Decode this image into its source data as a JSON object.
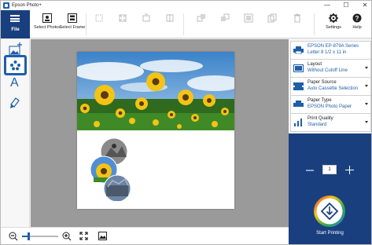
{
  "window": {
    "title": "Epson Photo+",
    "controls": {
      "minimize": "—",
      "maximize": "☐",
      "close": "✕"
    }
  },
  "ribbon": {
    "file_label": "File",
    "buttons": [
      {
        "label": "Select Photos",
        "enabled": true
      },
      {
        "label": "Select Frame",
        "enabled": true
      },
      {
        "label": "",
        "enabled": false
      },
      {
        "label": "",
        "enabled": false
      },
      {
        "label": "",
        "enabled": false
      },
      {
        "label": "",
        "enabled": false
      },
      {
        "label": "",
        "enabled": false
      },
      {
        "label": "",
        "enabled": false
      },
      {
        "label": "",
        "enabled": false
      },
      {
        "label": "",
        "enabled": false
      },
      {
        "label": "",
        "enabled": false
      }
    ],
    "settings_label": "Settings",
    "help_label": "Help"
  },
  "tools": [
    {
      "icon": "add-photo-icon",
      "active": false
    },
    {
      "icon": "stamp-icon",
      "active": true
    },
    {
      "icon": "text-icon",
      "active": false,
      "glyph": "A"
    },
    {
      "icon": "background-icon",
      "active": false
    }
  ],
  "settings": {
    "printer": {
      "line1": "EPSON EP-879A Series",
      "line2": "Letter 8 1/2 x 11 in"
    },
    "layout": {
      "label": "Layout",
      "value": "Without Cutoff Line"
    },
    "paper_source": {
      "label": "Paper Source",
      "value": "Auto Cassette Selection"
    },
    "paper_type": {
      "label": "Paper Type",
      "value": "EPSON Photo Paper"
    },
    "print_quality": {
      "label": "Print Quality",
      "value": "Standard"
    }
  },
  "print": {
    "copies": "1",
    "start_label": "Start Printing"
  },
  "colors": {
    "accent": "#1a3f7e",
    "link": "#1f5fa8",
    "canvas": "#9a9a9a"
  }
}
